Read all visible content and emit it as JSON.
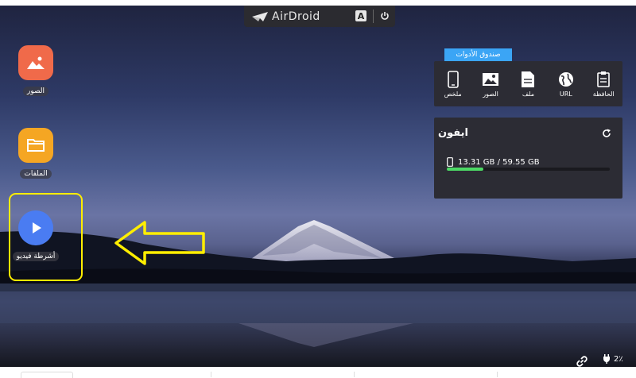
{
  "header": {
    "brand": "AirDroid",
    "font_button": "A",
    "icons": {
      "logo": "paper-plane-icon",
      "power": "power-icon"
    }
  },
  "desktop_apps": [
    {
      "label": "الصور",
      "icon": "photos-icon",
      "color": "#f06a4a"
    },
    {
      "label": "الملفات",
      "icon": "folder-icon",
      "color": "#f5a623"
    },
    {
      "label": "أشرطة فيديو",
      "icon": "video-play-icon",
      "color": "#4a7cf2",
      "highlighted": true
    }
  ],
  "toolbox": {
    "title": "صندوق الأدوات",
    "tools": [
      {
        "label": "ملخص",
        "icon": "phone-icon"
      },
      {
        "label": "الصور",
        "icon": "image-icon"
      },
      {
        "label": "ملف",
        "icon": "file-icon"
      },
      {
        "label": "URL",
        "icon": "globe-icon"
      },
      {
        "label": "الحافظة",
        "icon": "clipboard-icon"
      }
    ]
  },
  "device": {
    "name": "ايفون",
    "storage_text": "13.31 GB / 59.55 GB",
    "storage_used_fraction": 0.2235
  },
  "status": {
    "battery_text": "2٪",
    "icons": {
      "link": "link-icon",
      "battery": "charging-icon"
    }
  },
  "colors": {
    "accent": "#3ba5f5",
    "storage_bar": "#4cd964",
    "highlight": "#ffee00",
    "panel": "#2c2c34"
  }
}
